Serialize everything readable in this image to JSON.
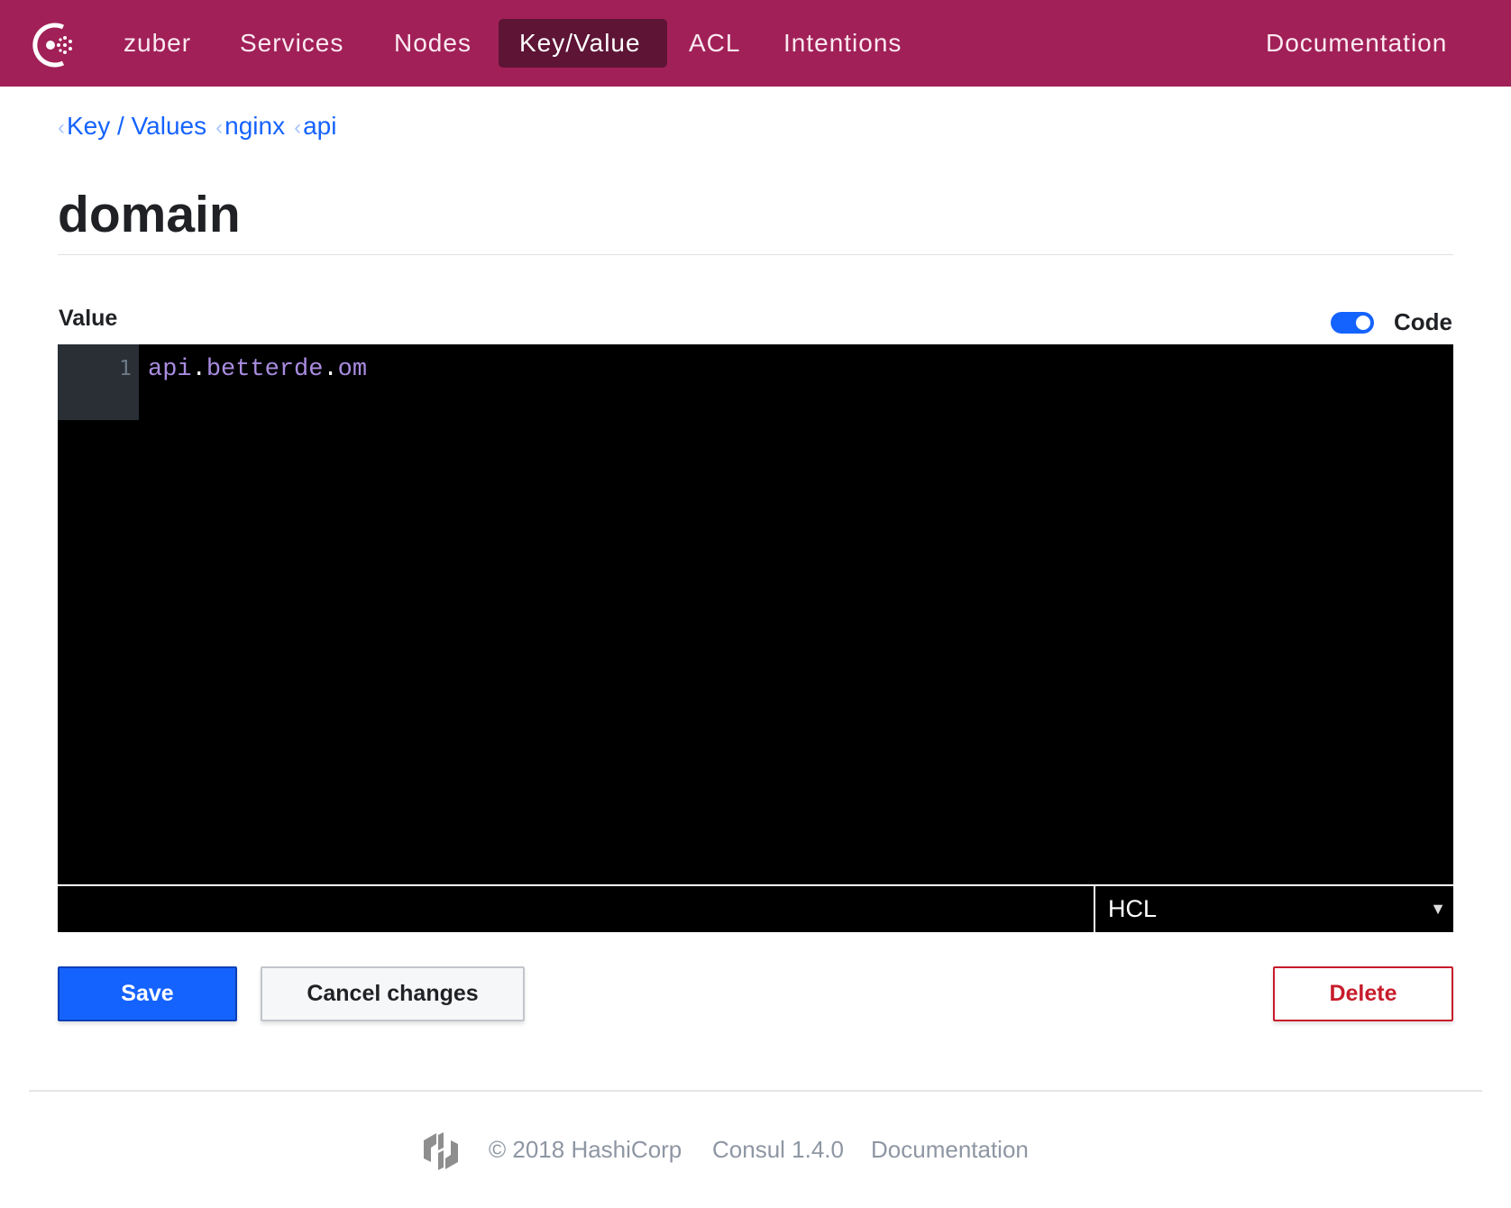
{
  "header": {
    "brand_color": "#a12058",
    "nav": [
      "zuber",
      "Services",
      "Nodes",
      "Key/Value",
      "ACL",
      "Intentions"
    ],
    "active": "Key/Value",
    "documentation": "Documentation"
  },
  "breadcrumbs": [
    "Key / Values",
    "nginx",
    "api"
  ],
  "page": {
    "title": "domain"
  },
  "form": {
    "value_label": "Value",
    "code_toggle": {
      "label": "Code",
      "on": true
    },
    "editor": {
      "line_number": "1",
      "code_parts": [
        "api",
        ".",
        "betterde",
        ".",
        "om"
      ]
    },
    "mode": "HCL",
    "save": "Save",
    "cancel": "Cancel changes",
    "delete": "Delete"
  },
  "footer": {
    "copyright": "© 2018 HashiCorp",
    "version": "Consul 1.4.0",
    "documentation": "Documentation"
  }
}
